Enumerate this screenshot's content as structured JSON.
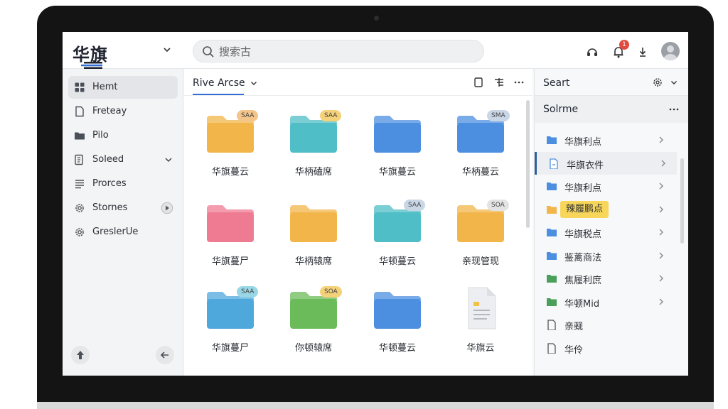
{
  "app": {
    "logo": "华旗"
  },
  "search": {
    "placeholder": "搜索古"
  },
  "notifications": {
    "count": "1"
  },
  "sidebar": {
    "items": [
      {
        "label": "Hemt",
        "icon": "home-icon",
        "active": true
      },
      {
        "label": "Freteay",
        "icon": "document-icon"
      },
      {
        "label": "Pilo",
        "icon": "folder-icon"
      },
      {
        "label": "Soleed",
        "icon": "shared-icon",
        "expandable": true
      },
      {
        "label": "Prorces",
        "icon": "list-icon"
      },
      {
        "label": "Stornes",
        "icon": "gear-icon"
      },
      {
        "label": "GreslerUe",
        "icon": "gear-icon"
      }
    ]
  },
  "main": {
    "title": "Rive Arcse",
    "tiles": [
      {
        "label": "华旗蔓云",
        "color": "#f2b54a",
        "tag": "SAA",
        "tag_color": "#f3c58a"
      },
      {
        "label": "华柄磕席",
        "color": "#4fbec6",
        "tag": "SAA",
        "tag_color": "#f5d27a"
      },
      {
        "label": "华旗蔓云",
        "color": "#4c8fe0",
        "tag": "",
        "tag_color": ""
      },
      {
        "label": "华柄蔓云",
        "color": "#4c8fe0",
        "tag": "SMA",
        "tag_color": "#c9d6e6"
      },
      {
        "label": "华旗蔓尸",
        "color": "#ef7b92",
        "tag": "",
        "tag_color": ""
      },
      {
        "label": "华柄辕席",
        "color": "#f2b54a",
        "tag": "",
        "tag_color": ""
      },
      {
        "label": "华顿蔓云",
        "color": "#4fbec6",
        "tag": "SAA",
        "tag_color": "#c9d6e6"
      },
      {
        "label": "亲现管现",
        "color": "#f2b54a",
        "tag": "SOA",
        "tag_color": "#e3e3e3"
      },
      {
        "label": "华旗蔓尸",
        "color": "#4fa8dc",
        "tag": "SAA",
        "tag_color": "#9ad7e6"
      },
      {
        "label": "你顿辕席",
        "color": "#6cbb5a",
        "tag": "SOA",
        "tag_color": "#f5d27a"
      },
      {
        "label": "华顿蔓云",
        "color": "#4c8fe0",
        "tag": "",
        "tag_color": ""
      },
      {
        "label": "华旗云",
        "color": "#e9ebee",
        "tag": "",
        "tag_color": ""
      }
    ]
  },
  "right": {
    "header": "Seart",
    "subheader": "Solrme",
    "items": [
      {
        "label": "华旗利点",
        "icon": "folder-icon",
        "color": "#4c8fe0"
      },
      {
        "label": "华旗衣件",
        "icon": "document-icon",
        "color": "#4c8fe0",
        "selected": true
      },
      {
        "label": "华旗利点",
        "icon": "folder-icon",
        "color": "#4c8fe0"
      },
      {
        "label": "辣履鹏点",
        "icon": "folder-icon",
        "color": "#f2b54a",
        "highlight": true
      },
      {
        "label": "华旗税点",
        "icon": "folder-icon",
        "color": "#4c8fe0"
      },
      {
        "label": "鉴蓠商法",
        "icon": "folder-icon",
        "color": "#4c8fe0"
      },
      {
        "label": "焦履利庶",
        "icon": "folder-icon",
        "color": "#4aa05a"
      },
      {
        "label": "华顿Mid",
        "icon": "folder-icon",
        "color": "#4aa05a"
      },
      {
        "label": "亲觋",
        "icon": "file-icon",
        "color": "#555"
      },
      {
        "label": "华伶",
        "icon": "file-icon",
        "color": "#555"
      }
    ]
  }
}
